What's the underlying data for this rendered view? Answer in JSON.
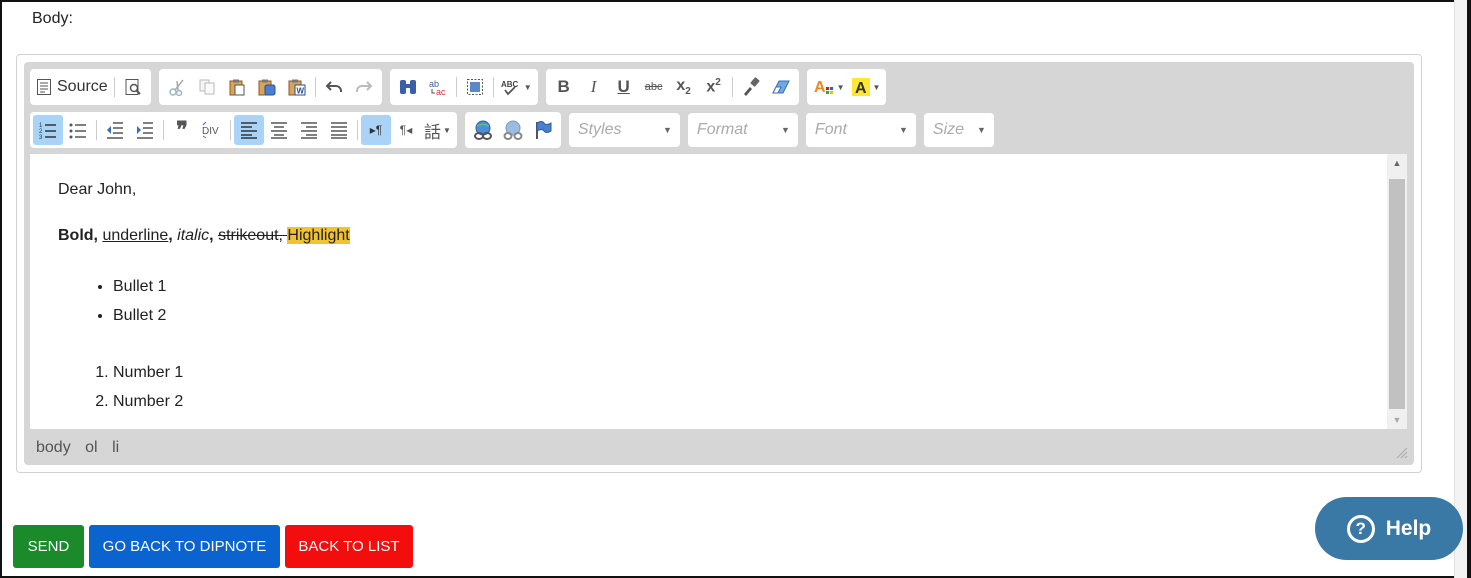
{
  "form": {
    "body_label": "Body:"
  },
  "toolbar": {
    "source_label": "Source",
    "styles_placeholder": "Styles",
    "format_placeholder": "Format",
    "font_placeholder": "Font",
    "size_placeholder": "Size"
  },
  "content": {
    "greeting": "Dear John,",
    "bold": "Bold",
    "sep1": ", ",
    "underline": "underline",
    "sep2": ", ",
    "italic": "italic",
    "sep3": ", ",
    "strikeout": "strikeout",
    "sep4": ", ",
    "highlight": "Highlight",
    "bullets": [
      "Bullet 1",
      "Bullet 2"
    ],
    "numbers": [
      "Number 1",
      "Number 2"
    ]
  },
  "pathbar": [
    "body",
    "ol",
    "li"
  ],
  "actions": {
    "send": "SEND",
    "go_back": "GO BACK TO DIPNOTE",
    "back_list": "BACK TO LIST"
  },
  "help": {
    "label": "Help"
  },
  "colors": {
    "send": "#1b8a2a",
    "go_back": "#0a63cf",
    "back_list": "#f40d0d",
    "help": "#3a79a6",
    "highlight": "#f1c231",
    "active_button": "#a9d4f7"
  }
}
